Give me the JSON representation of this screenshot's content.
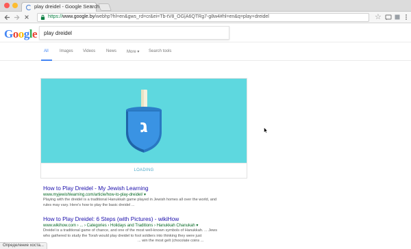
{
  "browser": {
    "tab_title": "play dreidel - Google Search",
    "tab_close": "×",
    "url_protocol": "https://",
    "url_host": "www.google.by",
    "url_path": "/webhp?hl=en&gws_rd=cr&ei=Tb-tV8_OG|A6QTRg7-g8w4#hl=en&q=play+dreidel",
    "star_glyph": "☆",
    "colors": {
      "close": "#fc5b57",
      "minimize": "#fdbc2e",
      "maximize": "#28c840"
    }
  },
  "google": {
    "logo_letters": [
      {
        "ch": "G",
        "color": "#4285f4"
      },
      {
        "ch": "o",
        "color": "#ea4335"
      },
      {
        "ch": "o",
        "color": "#fbbc05"
      },
      {
        "ch": "g",
        "color": "#4285f4"
      },
      {
        "ch": "l",
        "color": "#34a853"
      },
      {
        "ch": "e",
        "color": "#ea4335"
      }
    ],
    "query": "play dreidel"
  },
  "search_tabs": [
    {
      "label": "All",
      "active": true
    },
    {
      "label": "Images",
      "active": false
    },
    {
      "label": "Videos",
      "active": false
    },
    {
      "label": "News",
      "active": false
    },
    {
      "label": "More ▾",
      "active": false
    },
    {
      "label": "Search tools",
      "active": false
    }
  ],
  "card": {
    "loading_text": "LOADING",
    "dreidel_letter": "ג",
    "banner_color": "#5ed8df"
  },
  "results": [
    {
      "title": "How to Play Dreidel - My Jewish Learning",
      "url": "www.myjewishlearning.com/article/how-to-play-dreidel/ ▾",
      "snippet_lines": [
        "Playing with the dreidel is a traditional Hanukkah game played in Jewish homes all over the world, and",
        "rules may vary. Here's how to play the basic dreidel ..."
      ]
    },
    {
      "title": "How to Play Dreidel: 6 Steps (with Pictures) - wikiHow",
      "url": "www.wikihow.com › ... › Categories › Holidays and Traditions › Hanukkah Chanukah ▾",
      "snippet_lines": [
        "Dreidel is a traditional game of chance, and one of the most well-known symbols of Hanukkah. ... Jews",
        "who gathered to study the Torah would play dreidel to fool soldiers into thinking they were just",
        "... win the most gelt (chocolate coins ..."
      ]
    }
  ],
  "status_text": "Определение хоста..."
}
